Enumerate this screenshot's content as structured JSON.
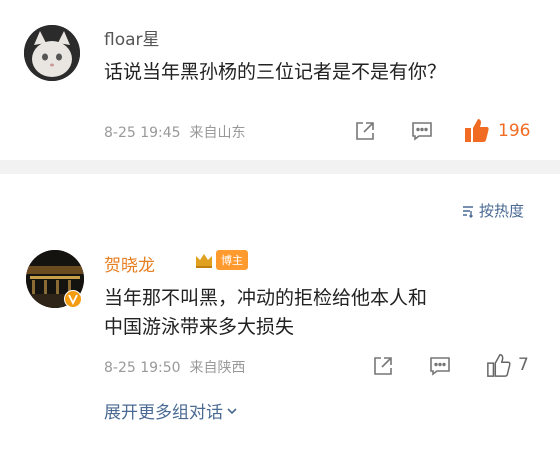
{
  "comments": [
    {
      "user": "floar星",
      "text": "话说当年黑孙杨的三位记者是不是有你？",
      "date": "8-25 19:45",
      "location": "来自山东",
      "likes": "196",
      "liked": true
    },
    {
      "user": "贺晓龙",
      "badge": "博主",
      "text": "当年那不叫黑，冲动的拒检给他本人和中国游泳带来多大损失",
      "date": "8-25 19:50",
      "location": "来自陕西",
      "likes": "7",
      "liked": false
    }
  ],
  "sort_label": "按热度",
  "expand_label": "展开更多组对话",
  "colors": {
    "like_active": "#f26b22",
    "link": "#4a6a93",
    "vip": "#e67e22"
  }
}
